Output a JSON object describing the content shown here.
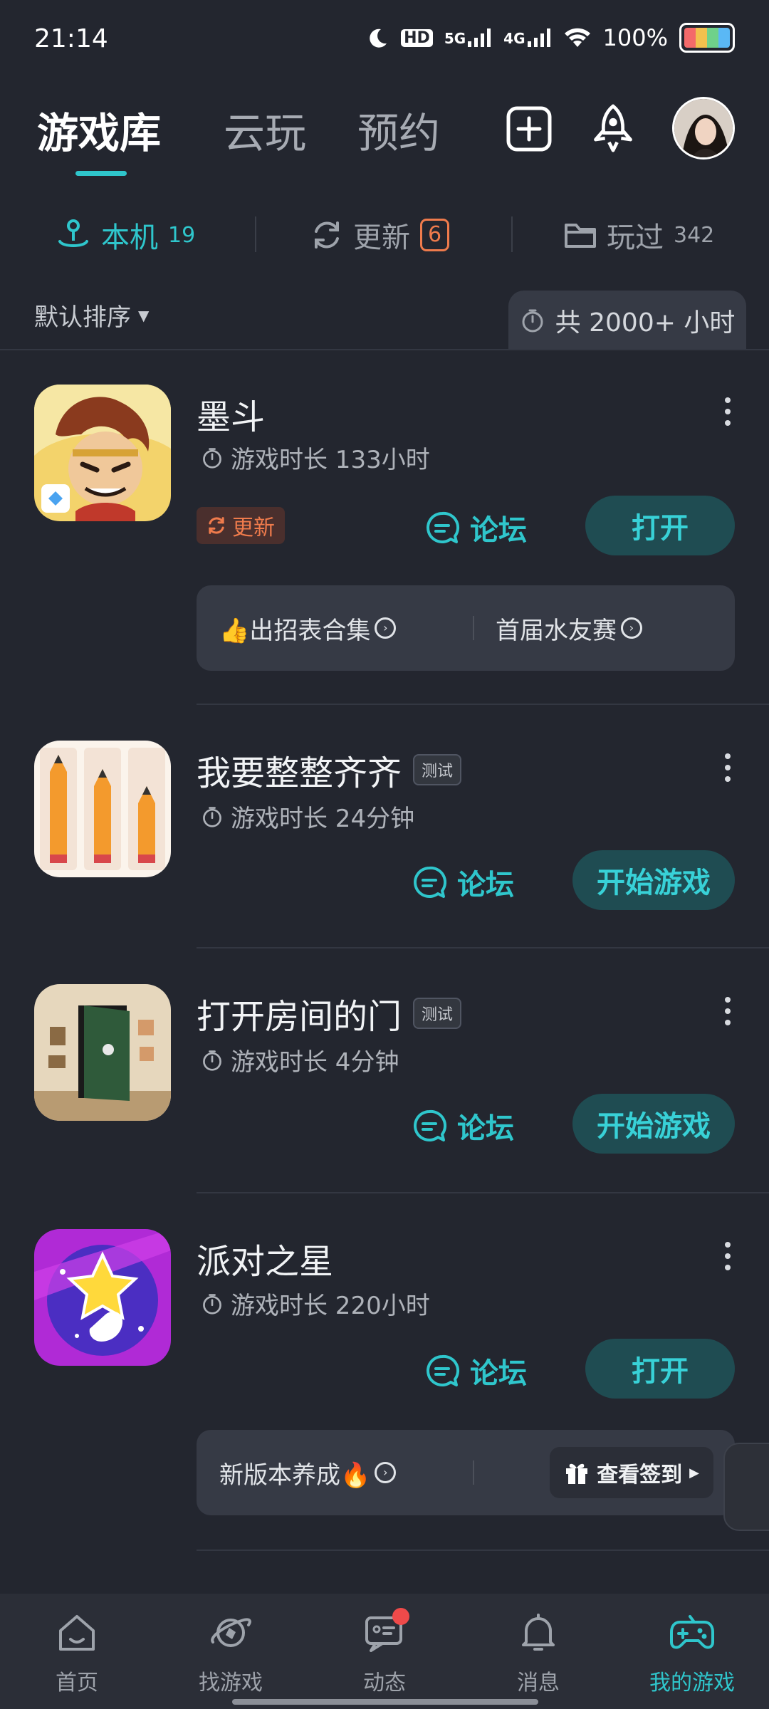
{
  "status_bar": {
    "time": "21:14",
    "network_hd": "HD",
    "network_5g": "5G",
    "network_4g": "4G",
    "battery_percent": "100%"
  },
  "top_tabs": [
    {
      "label": "游戏库",
      "active": true
    },
    {
      "label": "云玩",
      "active": false
    },
    {
      "label": "预约",
      "active": false
    }
  ],
  "header_icons": [
    "plus-square-icon",
    "rocket-icon",
    "avatar"
  ],
  "sub_tabs": [
    {
      "label": "本机",
      "count": "19",
      "icon": "joystick-icon",
      "active": true
    },
    {
      "label": "更新",
      "count": "6",
      "icon": "refresh-icon",
      "active": false
    },
    {
      "label": "玩过",
      "count": "342",
      "icon": "folder-icon",
      "active": false
    }
  ],
  "sort": {
    "label": "默认排序"
  },
  "total_playtime": "共 2000+ 小时",
  "games": [
    {
      "title": "墨斗",
      "test_tag": "",
      "playtime": "游戏时长 133小时",
      "update_label": "更新",
      "forum_label": "论坛",
      "action_label": "打开",
      "promos": [
        {
          "text": "👍出招表合集"
        },
        {
          "text": "首届水友赛"
        }
      ]
    },
    {
      "title": "我要整整齐齐",
      "test_tag": "测试",
      "playtime": "游戏时长 24分钟",
      "forum_label": "论坛",
      "action_label": "开始游戏"
    },
    {
      "title": "打开房间的门",
      "test_tag": "测试",
      "playtime": "游戏时长 4分钟",
      "forum_label": "论坛",
      "action_label": "开始游戏"
    },
    {
      "title": "派对之星",
      "test_tag": "",
      "playtime": "游戏时长 220小时",
      "forum_label": "论坛",
      "action_label": "打开",
      "promo_text": "新版本养成🔥",
      "signin_label": "查看签到"
    }
  ],
  "bottom_nav": [
    {
      "label": "首页",
      "icon": "home-icon",
      "active": false
    },
    {
      "label": "找游戏",
      "icon": "planet-icon",
      "active": false
    },
    {
      "label": "动态",
      "icon": "chat-icon",
      "active": false,
      "dot": true
    },
    {
      "label": "消息",
      "icon": "bell-icon",
      "active": false
    },
    {
      "label": "我的游戏",
      "icon": "gamepad-icon",
      "active": true
    }
  ],
  "colors": {
    "background": "#23262f",
    "accent": "#2fc6cc",
    "update_orange": "#ef7b4c",
    "button_bg": "#1f4c52"
  }
}
